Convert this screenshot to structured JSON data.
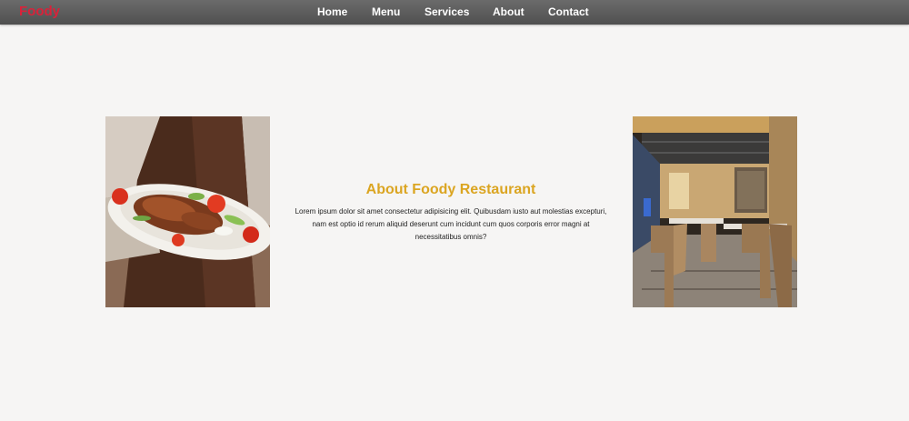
{
  "brand": {
    "logo_text": "Foody"
  },
  "nav": {
    "items": [
      {
        "label": "Home"
      },
      {
        "label": "Menu"
      },
      {
        "label": "Services"
      },
      {
        "label": "About"
      },
      {
        "label": "Contact"
      }
    ]
  },
  "about": {
    "title": "About Foody Restaurant",
    "body": "Lorem ipsum dolor sit amet consectetur adipisicing elit. Quibusdam iusto aut molestias excepturi, nam est optio id rerum aliquid deserunt cum incidunt cum quos corporis error magni at necessitatibus omnis?"
  },
  "colors": {
    "navbar_bg": "#5a5a5a",
    "logo": "#d9223a",
    "title": "#dba521",
    "page_bg": "#f6f5f4"
  }
}
